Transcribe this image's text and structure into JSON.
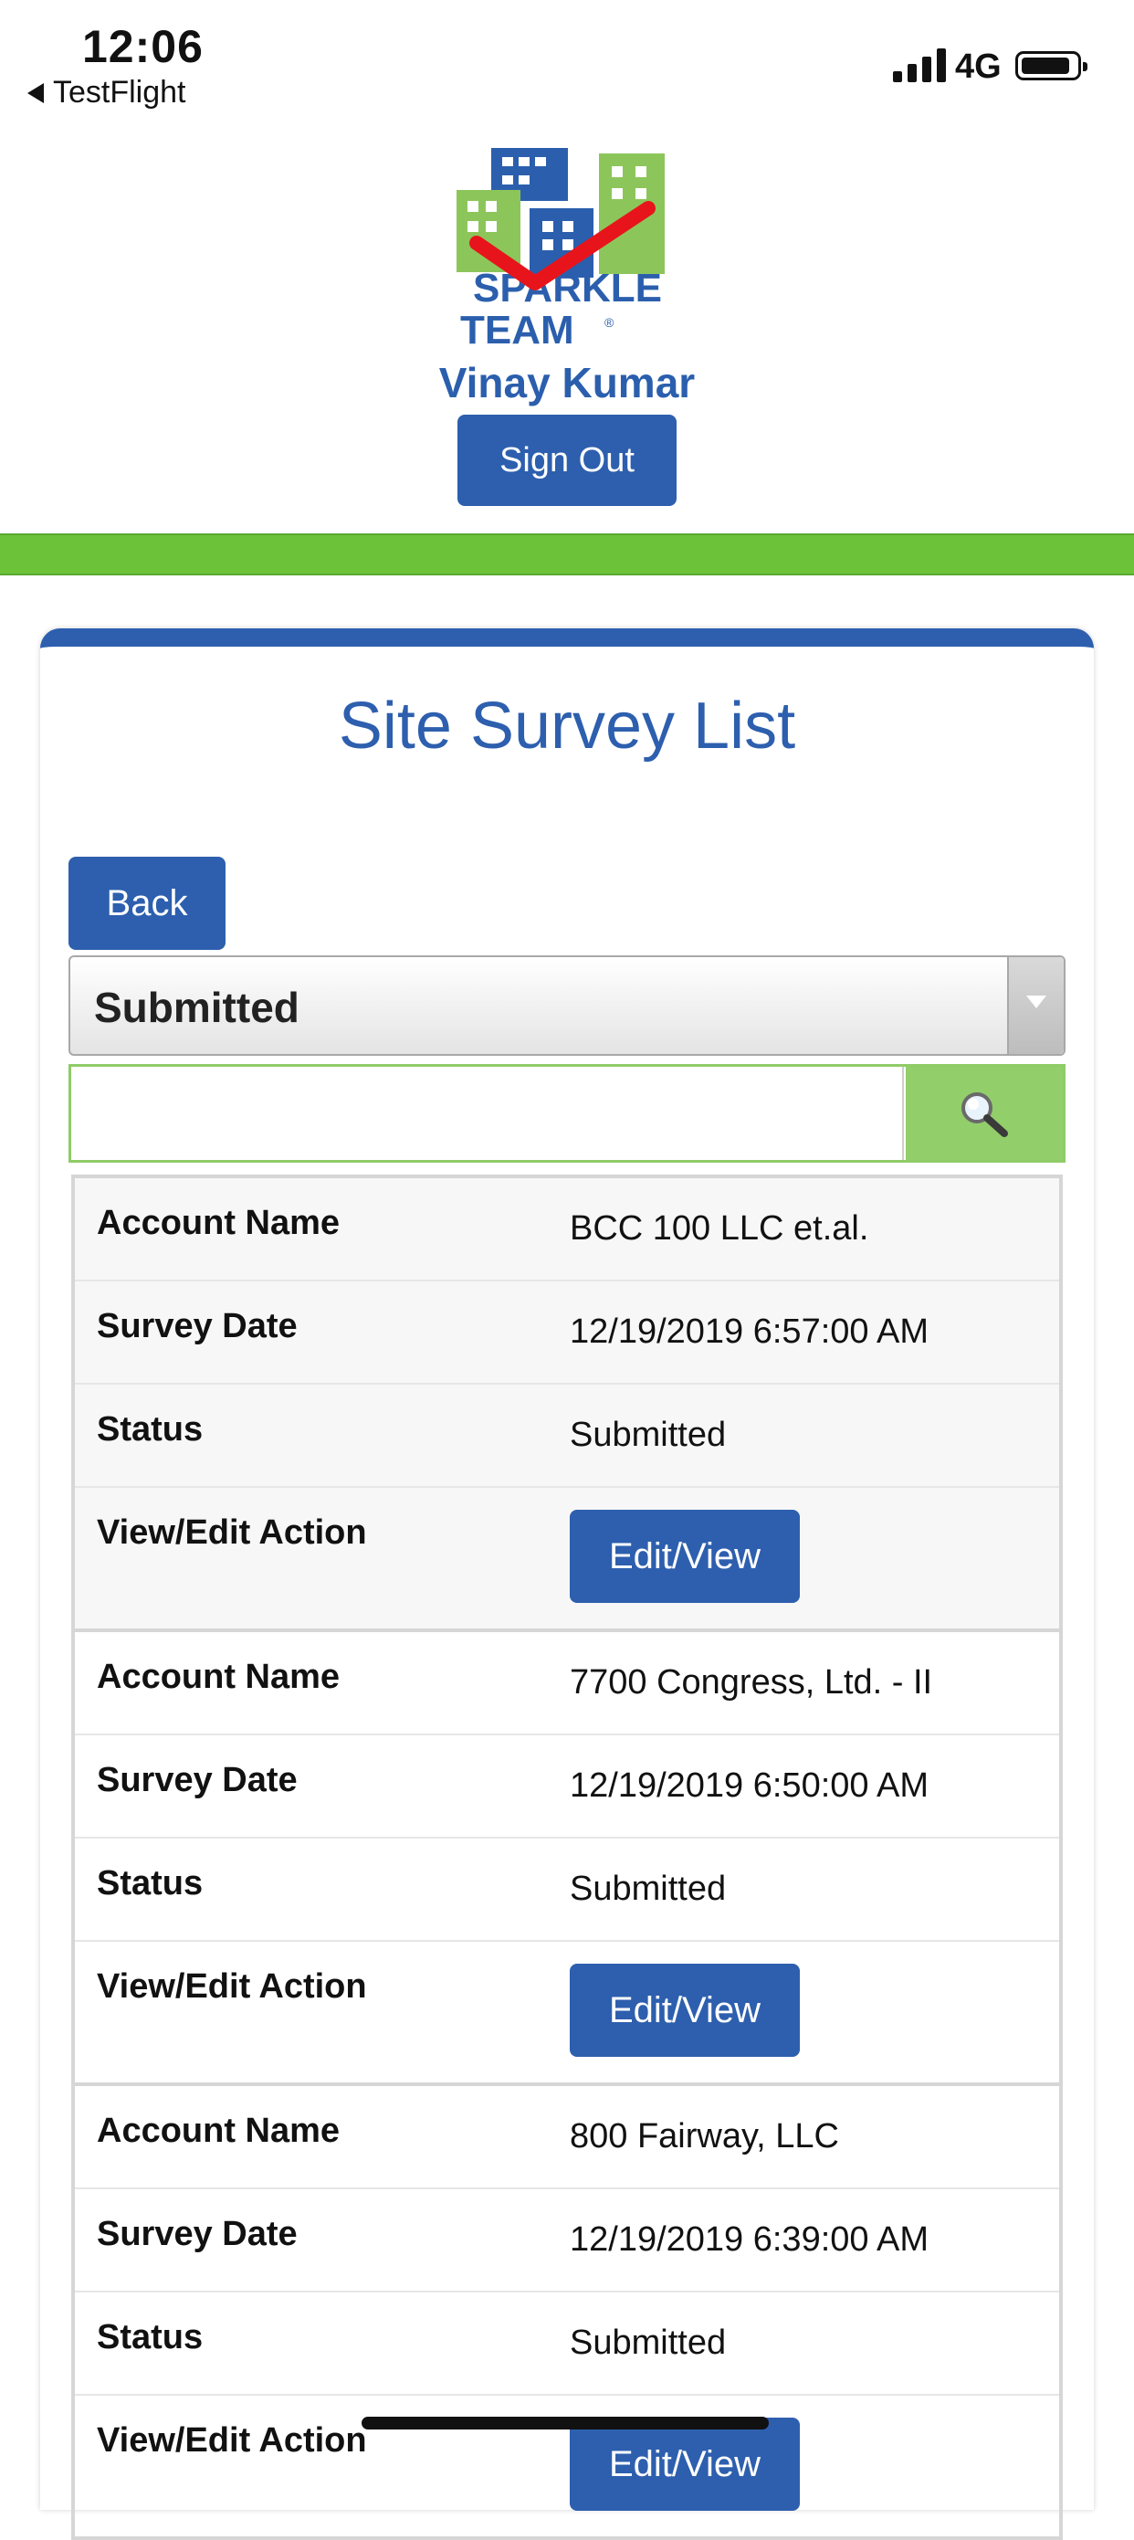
{
  "status_bar": {
    "time": "12:06",
    "back_app": "TestFlight",
    "network": "4G"
  },
  "header": {
    "logo_text_1": "SPARKLE",
    "logo_text_2": "TEAM",
    "logo_mark": "®",
    "user_name": "Vinay Kumar",
    "sign_out_label": "Sign Out"
  },
  "page": {
    "title": "Site Survey List",
    "back_label": "Back",
    "filter_selected": "Submitted",
    "search_value": "",
    "search_icon": "magnifier-icon"
  },
  "labels": {
    "account_name": "Account Name",
    "survey_date": "Survey Date",
    "status": "Status",
    "action": "View/Edit Action",
    "edit_button": "Edit/View"
  },
  "records": [
    {
      "account_name": "BCC 100 LLC et.al.",
      "survey_date": "12/19/2019 6:57:00 AM",
      "status": "Submitted"
    },
    {
      "account_name": "7700 Congress, Ltd. - II",
      "survey_date": "12/19/2019 6:50:00 AM",
      "status": "Submitted"
    },
    {
      "account_name": "800 Fairway, LLC",
      "survey_date": "12/19/2019 6:39:00 AM",
      "status": "Submitted"
    }
  ],
  "colors": {
    "brand_blue": "#2d5fae",
    "brand_green": "#6cc33a",
    "check_red": "#e8141b"
  }
}
